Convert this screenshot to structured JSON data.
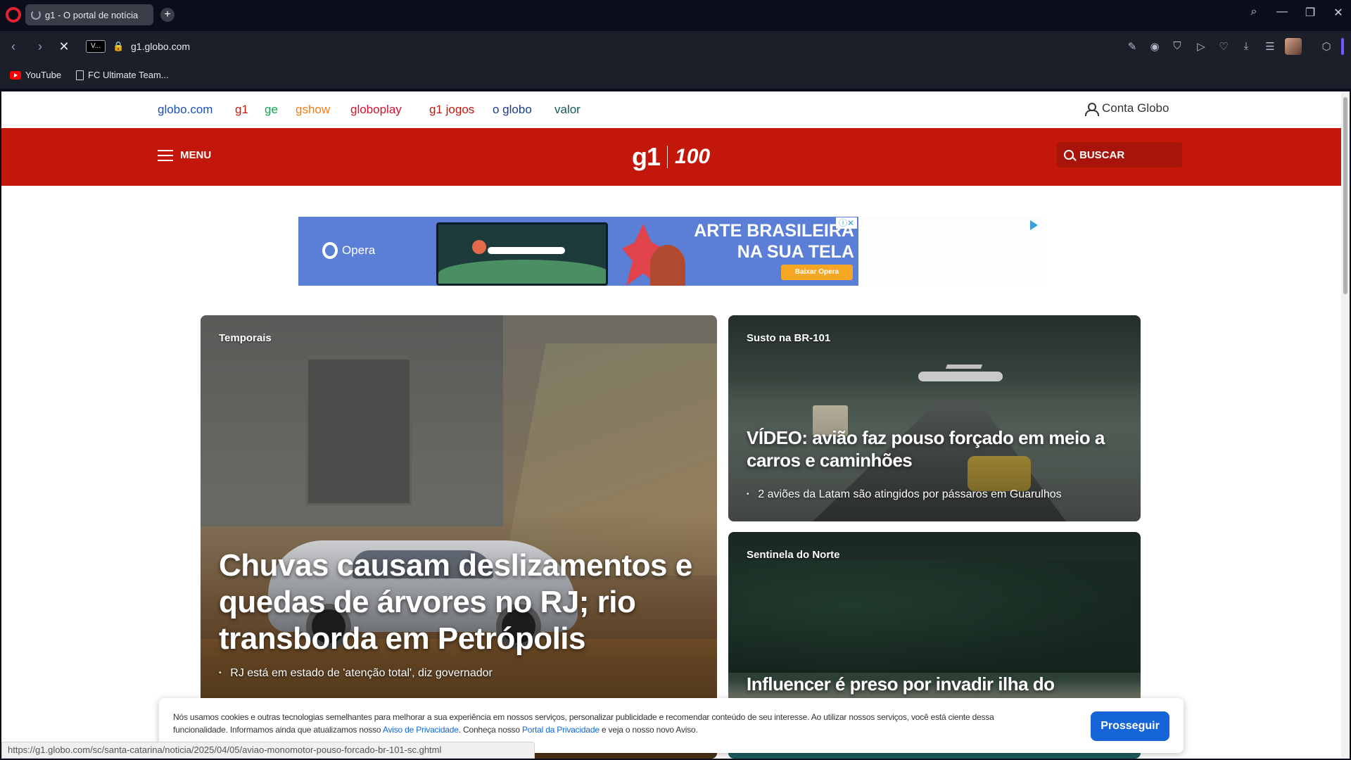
{
  "browser": {
    "tab_title": "g1 - O portal de notícia",
    "new_tab": "+",
    "url": "g1.globo.com",
    "site_badge": "V...",
    "bookmarks": [
      "YouTube",
      "FC Ultimate Team..."
    ],
    "status_url": "https://g1.globo.com/sc/santa-catarina/noticia/2025/04/05/aviao-monomotor-pouso-forcado-br-101-sc.ghtml"
  },
  "topnav": {
    "links": [
      {
        "label": "globo.com",
        "color": "#1a4fb8"
      },
      {
        "label": "g1",
        "color": "#c4170c"
      },
      {
        "label": "ge",
        "color": "#06aa48"
      },
      {
        "label": "gshow",
        "color": "#fd7a0e"
      },
      {
        "label": "globoplay",
        "color": "#d7102c"
      },
      {
        "label": "g1 jogos",
        "color": "#c4170c"
      },
      {
        "label": "o globo",
        "color": "#1a3a8c"
      },
      {
        "label": "valor",
        "color": "#0f5a58"
      }
    ],
    "account": "Conta Globo"
  },
  "header": {
    "menu": "MENU",
    "logo": "g1",
    "anniversary": "100",
    "search": "BUSCAR",
    "brand_color": "#c4170c"
  },
  "ad": {
    "brand": "Opera",
    "headline_1": "ARTE BRASILEIRA",
    "headline_2": "NA SUA TELA",
    "cta": "Baixar Opera",
    "adchoices": "ⓘ✕"
  },
  "stories": [
    {
      "label": "Temporais",
      "title": "Chuvas causam deslizamentos e quedas de árvores no RJ; rio transborda em Petrópolis",
      "related": "RJ está em estado de 'atenção total', diz governador"
    },
    {
      "label": "Susto na BR-101",
      "title": "VÍDEO: avião faz pouso forçado em meio a carros e caminhões",
      "related": "2 aviões da Latam são atingidos por pássaros em Guarulhos"
    },
    {
      "label": "Sentinela do Norte",
      "title": "Influencer é preso por invadir ilha do"
    }
  ],
  "cookie": {
    "text_1": "Nós usamos cookies e outras tecnologias semelhantes para melhorar a sua experiência em nossos serviços, personalizar publicidade e recomendar conteúdo de seu interesse. Ao utilizar nossos serviços, você está ciente dessa funcionalidade. Informamos ainda que atualizamos nosso ",
    "link_1": "Aviso de Privacidade",
    "text_2": ". Conheça nosso ",
    "link_2": "Portal da Privacidade",
    "text_3": " e veja o nosso novo Aviso.",
    "button": "Prosseguir"
  }
}
